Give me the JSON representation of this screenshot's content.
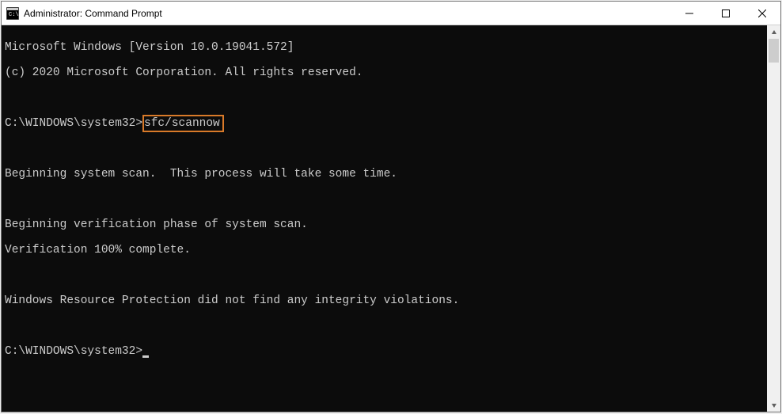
{
  "window": {
    "title": "Administrator: Command Prompt"
  },
  "terminal": {
    "line1": "Microsoft Windows [Version 10.0.19041.572]",
    "line2": "(c) 2020 Microsoft Corporation. All rights reserved.",
    "blank1": " ",
    "prompt1_prefix": "C:\\WINDOWS\\system32>",
    "prompt1_command": "sfc/scannow",
    "blank2": " ",
    "line3": "Beginning system scan.  This process will take some time.",
    "blank3": " ",
    "line4": "Beginning verification phase of system scan.",
    "line5": "Verification 100% complete.",
    "blank4": " ",
    "line6": "Windows Resource Protection did not find any integrity violations.",
    "blank5": " ",
    "prompt2": "C:\\WINDOWS\\system32>"
  }
}
